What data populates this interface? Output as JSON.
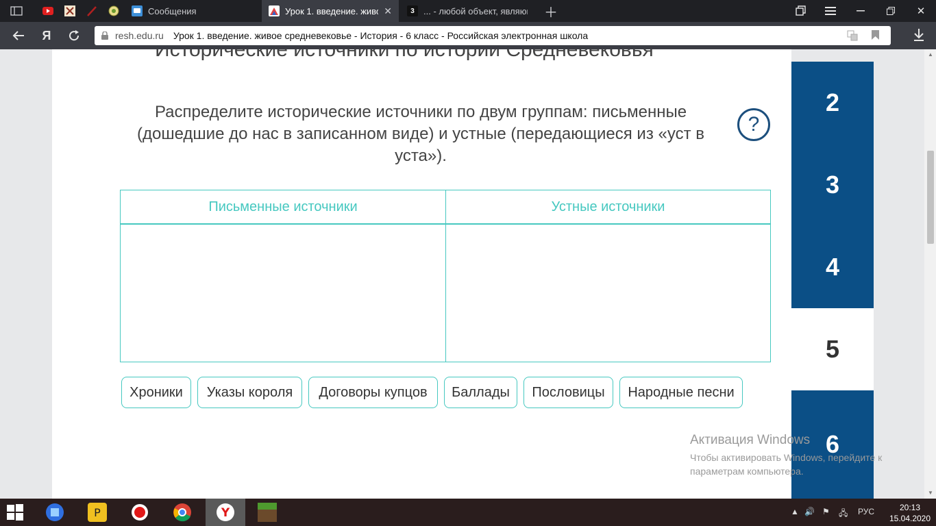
{
  "tabs": [
    {
      "label": "",
      "favicon": "youtube-icon",
      "color": "#e02020"
    },
    {
      "label": "",
      "favicon": "emblem-icon",
      "color": "#c9a060"
    },
    {
      "label": "",
      "favicon": "feather-icon",
      "color": "#a02020"
    },
    {
      "label": "",
      "favicon": "coat-of-arms-icon",
      "color": "#d8c85a"
    },
    {
      "label": "Сообщения",
      "favicon": "chat-icon",
      "color": "#3d8fd8"
    },
    {
      "label": "Урок 1. введение. живое средневековье",
      "favicon": "resh-icon",
      "color": "#ffffff",
      "active": true
    },
    {
      "label": "... - любой объект, являющийся",
      "favicon": "z-icon",
      "color": "#111111",
      "badge": "3"
    }
  ],
  "address": {
    "domain": "resh.edu.ru",
    "title": "Урок 1. введение. живое средневековье - История - 6 класс - Российская электронная школа"
  },
  "page": {
    "heading": "Исторические источники по истории Средневековья",
    "instruction": "Распределите исторические источники по двум группам: письменные (дошедшие до нас в записанном виде) и устные (передающиеся из «уст в уста»).",
    "help_symbol": "?",
    "columns": [
      "Письменные источники",
      "Устные источники"
    ],
    "chips": [
      "Хроники",
      "Указы короля",
      "Договоры купцов",
      "Баллады",
      "Пословицы",
      "Народные песни"
    ],
    "steps": [
      "2",
      "3",
      "4",
      "5",
      "6"
    ],
    "current_step": "5"
  },
  "watermark": {
    "title": "Активация Windows",
    "text": "Чтобы активировать Windows, перейдите к параметрам компьютера."
  },
  "taskbar": {
    "lang": "РУС",
    "time": "20:13",
    "date": "15.04.2020"
  },
  "colors": {
    "accent_teal": "#46c8c0",
    "step_blue": "#0b4f86"
  }
}
